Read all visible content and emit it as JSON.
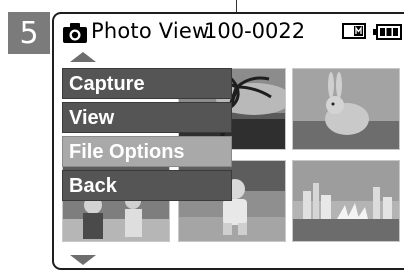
{
  "step_number": "5",
  "status_bar": {
    "mode_icon": "camera-icon",
    "mode_label": "Photo View",
    "file_number": "100-0022",
    "memory_icon": "internal-memory-icon",
    "battery_icon": "battery-full-icon"
  },
  "menu": {
    "items": [
      {
        "label": "Capture",
        "selected": false
      },
      {
        "label": "View",
        "selected": false
      },
      {
        "label": "File Options",
        "selected": true
      },
      {
        "label": "Back",
        "selected": false
      }
    ]
  },
  "thumbnails": [
    {
      "subject": "palm-tree-beach"
    },
    {
      "subject": "rabbit-on-grass"
    },
    {
      "subject": "people-in-park"
    },
    {
      "subject": "child-on-lawn"
    },
    {
      "subject": "city-skyline-opera-house"
    }
  ],
  "colors": {
    "menu_item_bg": "#555555",
    "menu_item_selected_bg": "#a9a9a9",
    "step_tab_bg": "#7b7b7b"
  }
}
